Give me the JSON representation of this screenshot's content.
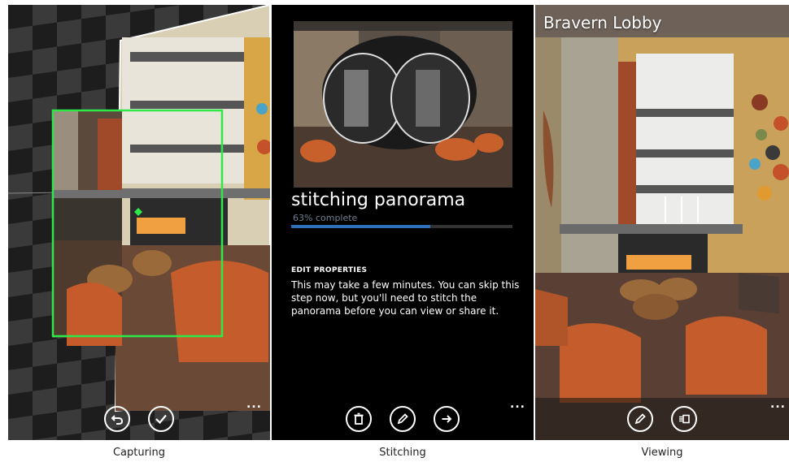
{
  "captions": {
    "capturing": "Capturing",
    "stitching": "Stitching",
    "viewing": "Viewing"
  },
  "stitching": {
    "title": "stitching panorama",
    "progress_text": "63% complete",
    "progress": 0.63,
    "edit_heading": "EDIT PROPERTIES",
    "edit_body": "This may take a few minutes. You can skip this step now, but you'll need to stitch the panorama before you can view or share it."
  },
  "viewing": {
    "title": "Bravern Lobby"
  },
  "appbar": {
    "more": "...",
    "capturing_icons": [
      "undo-icon",
      "check-icon"
    ],
    "stitching_icons": [
      "delete-icon",
      "edit-icon",
      "next-arrow-icon"
    ],
    "viewing_icons": [
      "edit-icon",
      "share-icon"
    ]
  },
  "colors": {
    "capture_frame": "#2ee84a",
    "progress": "#2e6fb8",
    "background": "#000000"
  }
}
